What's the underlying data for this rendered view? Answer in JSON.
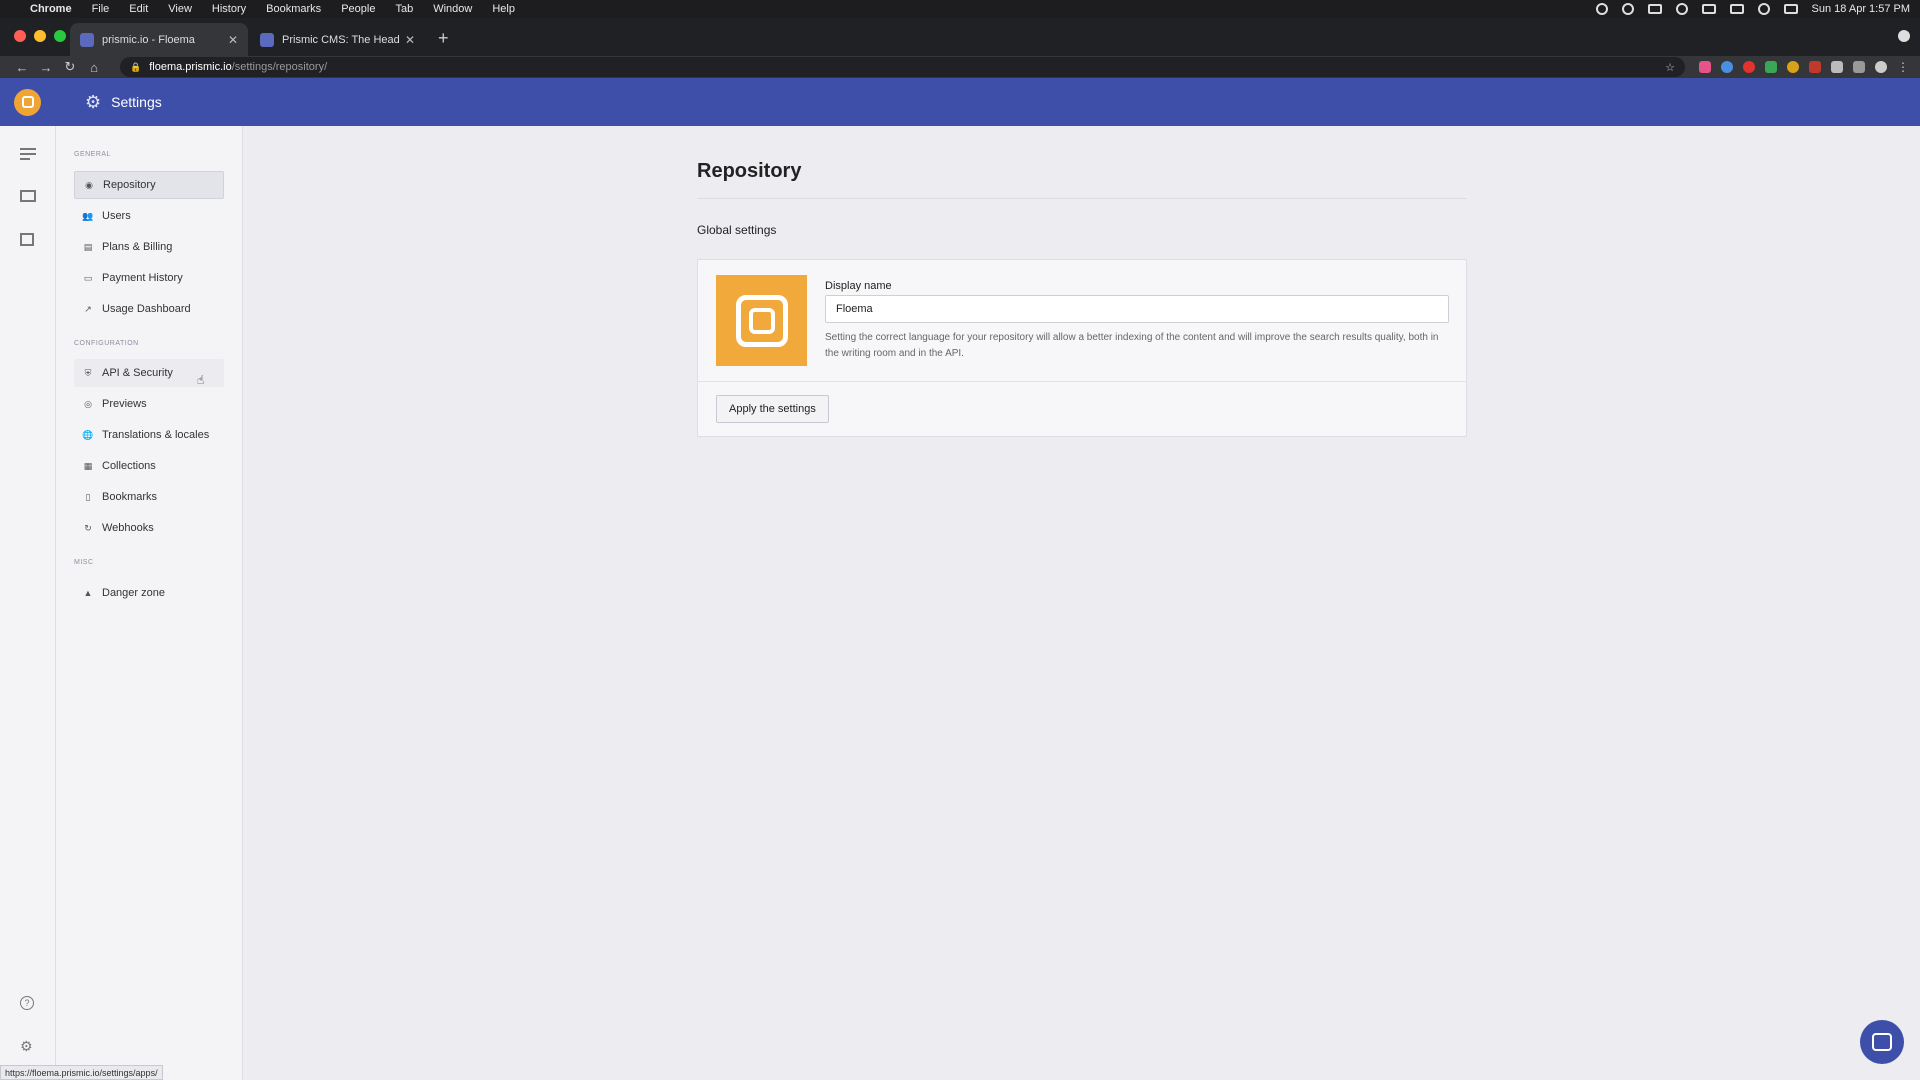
{
  "menubar": {
    "app": "Chrome",
    "items": [
      "File",
      "Edit",
      "View",
      "History",
      "Bookmarks",
      "People",
      "Tab",
      "Window",
      "Help"
    ],
    "clock": "Sun 18 Apr  1:57 PM"
  },
  "tabs": [
    {
      "title": "prismic.io - Floema"
    },
    {
      "title": "Prismic CMS: The Headless W"
    }
  ],
  "address": {
    "host": "floema.prismic.io",
    "path": "/settings/repository/"
  },
  "header": {
    "title": "Settings"
  },
  "sidebar": {
    "sections": [
      {
        "label": "GENERAL",
        "items": [
          {
            "label": "Repository",
            "icon": "repository-icon"
          },
          {
            "label": "Users",
            "icon": "users-icon"
          },
          {
            "label": "Plans & Billing",
            "icon": "billing-icon"
          },
          {
            "label": "Payment History",
            "icon": "card-icon"
          },
          {
            "label": "Usage Dashboard",
            "icon": "chart-icon"
          }
        ]
      },
      {
        "label": "CONFIGURATION",
        "items": [
          {
            "label": "API & Security",
            "icon": "shield-icon"
          },
          {
            "label": "Previews",
            "icon": "eye-icon"
          },
          {
            "label": "Translations & locales",
            "icon": "globe-icon"
          },
          {
            "label": "Collections",
            "icon": "collections-icon"
          },
          {
            "label": "Bookmarks",
            "icon": "bookmark-icon"
          },
          {
            "label": "Webhooks",
            "icon": "webhook-icon"
          }
        ]
      },
      {
        "label": "MISC",
        "items": [
          {
            "label": "Danger zone",
            "icon": "warning-icon"
          }
        ]
      }
    ]
  },
  "main": {
    "title": "Repository",
    "section_title": "Global settings",
    "field_label": "Display name",
    "field_value": "Floema",
    "hint": "Setting the correct language for your repository will allow a better indexing of the content and will improve the search results quality, both in the writing room and in the API.",
    "apply_label": "Apply the settings"
  },
  "status_url": "https://floema.prismic.io/settings/apps/",
  "colors": {
    "header": "#3d4fa8",
    "logo": "#f0a433"
  }
}
